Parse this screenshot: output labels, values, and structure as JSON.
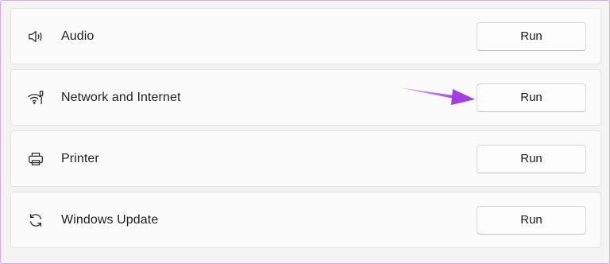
{
  "rows": [
    {
      "label": "Audio",
      "icon": "speaker-icon",
      "button": "Run"
    },
    {
      "label": "Network and Internet",
      "icon": "network-icon",
      "button": "Run"
    },
    {
      "label": "Printer",
      "icon": "printer-icon",
      "button": "Run"
    },
    {
      "label": "Windows Update",
      "icon": "sync-icon",
      "button": "Run"
    }
  ],
  "annotation": {
    "arrow_color": "#a43ee0"
  }
}
